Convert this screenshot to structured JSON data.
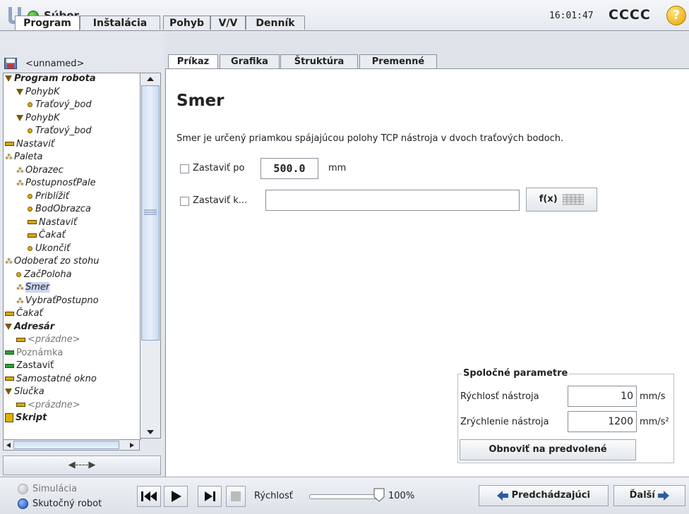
{
  "header": {
    "file_menu": "Súbor",
    "time": "16:01:47",
    "robot_name": "CCCC",
    "help": "?"
  },
  "main_tabs": [
    {
      "label": "Program",
      "active": true
    },
    {
      "label": "Inštalácia",
      "active": false
    },
    {
      "label": "Pohyb",
      "active": false
    },
    {
      "label": "V/V",
      "active": false
    },
    {
      "label": "Denník",
      "active": false
    }
  ],
  "program_name": "<unnamed>",
  "tree": [
    {
      "label": "Program robota",
      "icon": "triangle",
      "bold": true
    },
    {
      "label": "PohybK",
      "icon": "triangle"
    },
    {
      "label": "Traťový_bod",
      "icon": "waypoint"
    },
    {
      "label": "PohybK",
      "icon": "triangle"
    },
    {
      "label": "Traťový_bod",
      "icon": "waypoint"
    },
    {
      "label": "Nastaviť",
      "icon": "bar"
    },
    {
      "label": "Paleta",
      "icon": "pallet"
    },
    {
      "label": "Obrazec",
      "icon": "pallet"
    },
    {
      "label": "PostupnosťPale",
      "icon": "pallet"
    },
    {
      "label": "Priblížiť",
      "icon": "waypoint"
    },
    {
      "label": "BodObrazca",
      "icon": "waypoint"
    },
    {
      "label": "Nastaviť",
      "icon": "bar"
    },
    {
      "label": "Čakať",
      "icon": "bar"
    },
    {
      "label": "Ukončiť",
      "icon": "waypoint"
    },
    {
      "label": "Odoberať zo stohu",
      "icon": "pallet"
    },
    {
      "label": "ZačPoloha",
      "icon": "waypoint"
    },
    {
      "label": "Smer",
      "icon": "pallet",
      "selected": true
    },
    {
      "label": "VybraťPostupno",
      "icon": "pallet"
    },
    {
      "label": "Čakať",
      "icon": "bar"
    },
    {
      "label": "Adresár",
      "icon": "triangle",
      "bold": true
    },
    {
      "label": "<prázdne>",
      "icon": "bar",
      "gray": true
    },
    {
      "label": "Poznámka",
      "icon": "bar-green",
      "gray": true,
      "normal": true
    },
    {
      "label": "Zastaviť",
      "icon": "bar-green",
      "normal": true
    },
    {
      "label": "Samostatné okno",
      "icon": "bar"
    },
    {
      "label": "Slučka",
      "icon": "triangle"
    },
    {
      "label": "<prázdne>",
      "icon": "bar",
      "gray": true
    },
    {
      "label": "Skript",
      "icon": "script",
      "bold": true
    }
  ],
  "collapse_button": "◀----▶",
  "sub_tabs": [
    {
      "label": "Príkaz",
      "active": true
    },
    {
      "label": "Grafika",
      "active": false
    },
    {
      "label": "Štruktúra",
      "active": false
    },
    {
      "label": "Premenné",
      "active": false
    }
  ],
  "content": {
    "title": "Smer",
    "description": "Smer je určený priamkou spájajúcou polohy TCP nástroja v dvoch traťových bodoch.",
    "stop_after_label": "Zastaviť po",
    "stop_after_value": "500.0",
    "stop_after_unit": "mm",
    "stop_at_label": "Zastaviť k...",
    "stop_at_value": "",
    "fx_label": "f(x)"
  },
  "common_params": {
    "title": "Spoločné parametre",
    "speed_label": "Rýchlosť nástroja",
    "speed_value": "10",
    "speed_unit": "mm/s",
    "accel_label": "Zrýchlenie nástroja",
    "accel_value": "1200",
    "accel_unit": "mm/s²",
    "reset_label": "Obnoviť na predvolené"
  },
  "bottom": {
    "simulation_label": "Simulácia",
    "real_robot_label": "Skutočný robot",
    "speed_label": "Rýchlosť",
    "speed_value": "100%",
    "speed_fraction": 1.0,
    "prev_label": "Predchádzajúci",
    "next_label": "Ďalší"
  }
}
